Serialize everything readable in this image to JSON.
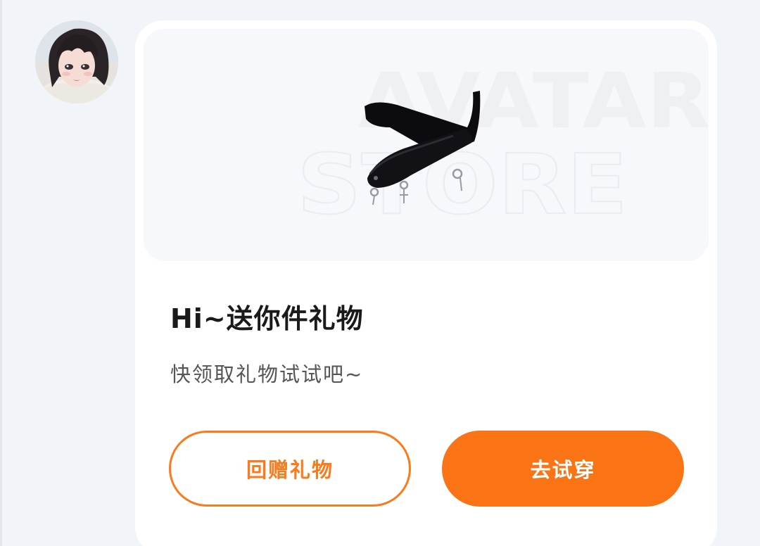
{
  "chat": {
    "sender_avatar": "girl-with-bangs-and-white-scarf",
    "message_card": {
      "watermark_line1": "AVATAR",
      "watermark_line2": "STORE",
      "gift_item": "black-strap-choker-with-cross-charms",
      "title": "Hi~送你件礼物",
      "subtitle": "快领取礼物试试吧~",
      "buttons": {
        "return_gift_label": "回赠礼物",
        "try_on_label": "去试穿"
      }
    }
  },
  "colors": {
    "accent": "#fa7415",
    "page_background": "#f1f4f8",
    "card_background": "#ffffff",
    "title_text": "#1a1a1a",
    "subtitle_text": "#555555"
  }
}
